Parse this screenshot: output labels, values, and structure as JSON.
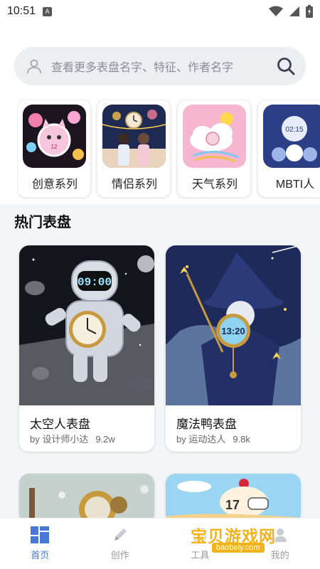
{
  "status": {
    "time": "10:51",
    "notif": "A"
  },
  "search": {
    "placeholder": "查看更多表盘名字、特征、作者名字"
  },
  "categories": [
    {
      "label": "创意系列"
    },
    {
      "label": "情侣系列"
    },
    {
      "label": "天气系列"
    },
    {
      "label": "MBTI人"
    }
  ],
  "hot": {
    "title": "热门表盘",
    "items": [
      {
        "name": "太空人表盘",
        "author": "by 设计师小达",
        "count": "9.2w",
        "clock": "09:00"
      },
      {
        "name": "魔法鸭表盘",
        "author": "by 运动达人",
        "count": "9.8k",
        "clock": "13:20"
      }
    ],
    "partial": [
      {
        "clock": "17"
      },
      {}
    ]
  },
  "nav": [
    {
      "label": "首页",
      "icon": "grid-icon",
      "active": true
    },
    {
      "label": "创作",
      "icon": "pen-icon",
      "active": false
    },
    {
      "label": "工具",
      "icon": "tool-icon",
      "active": false
    },
    {
      "label": "我的",
      "icon": "user-icon",
      "active": false
    }
  ],
  "watermark": {
    "main": "宝贝游戏网",
    "sub": "baobeiy.com"
  },
  "colors": {
    "accent": "#4a78d6",
    "watermark": "#f3b318"
  }
}
